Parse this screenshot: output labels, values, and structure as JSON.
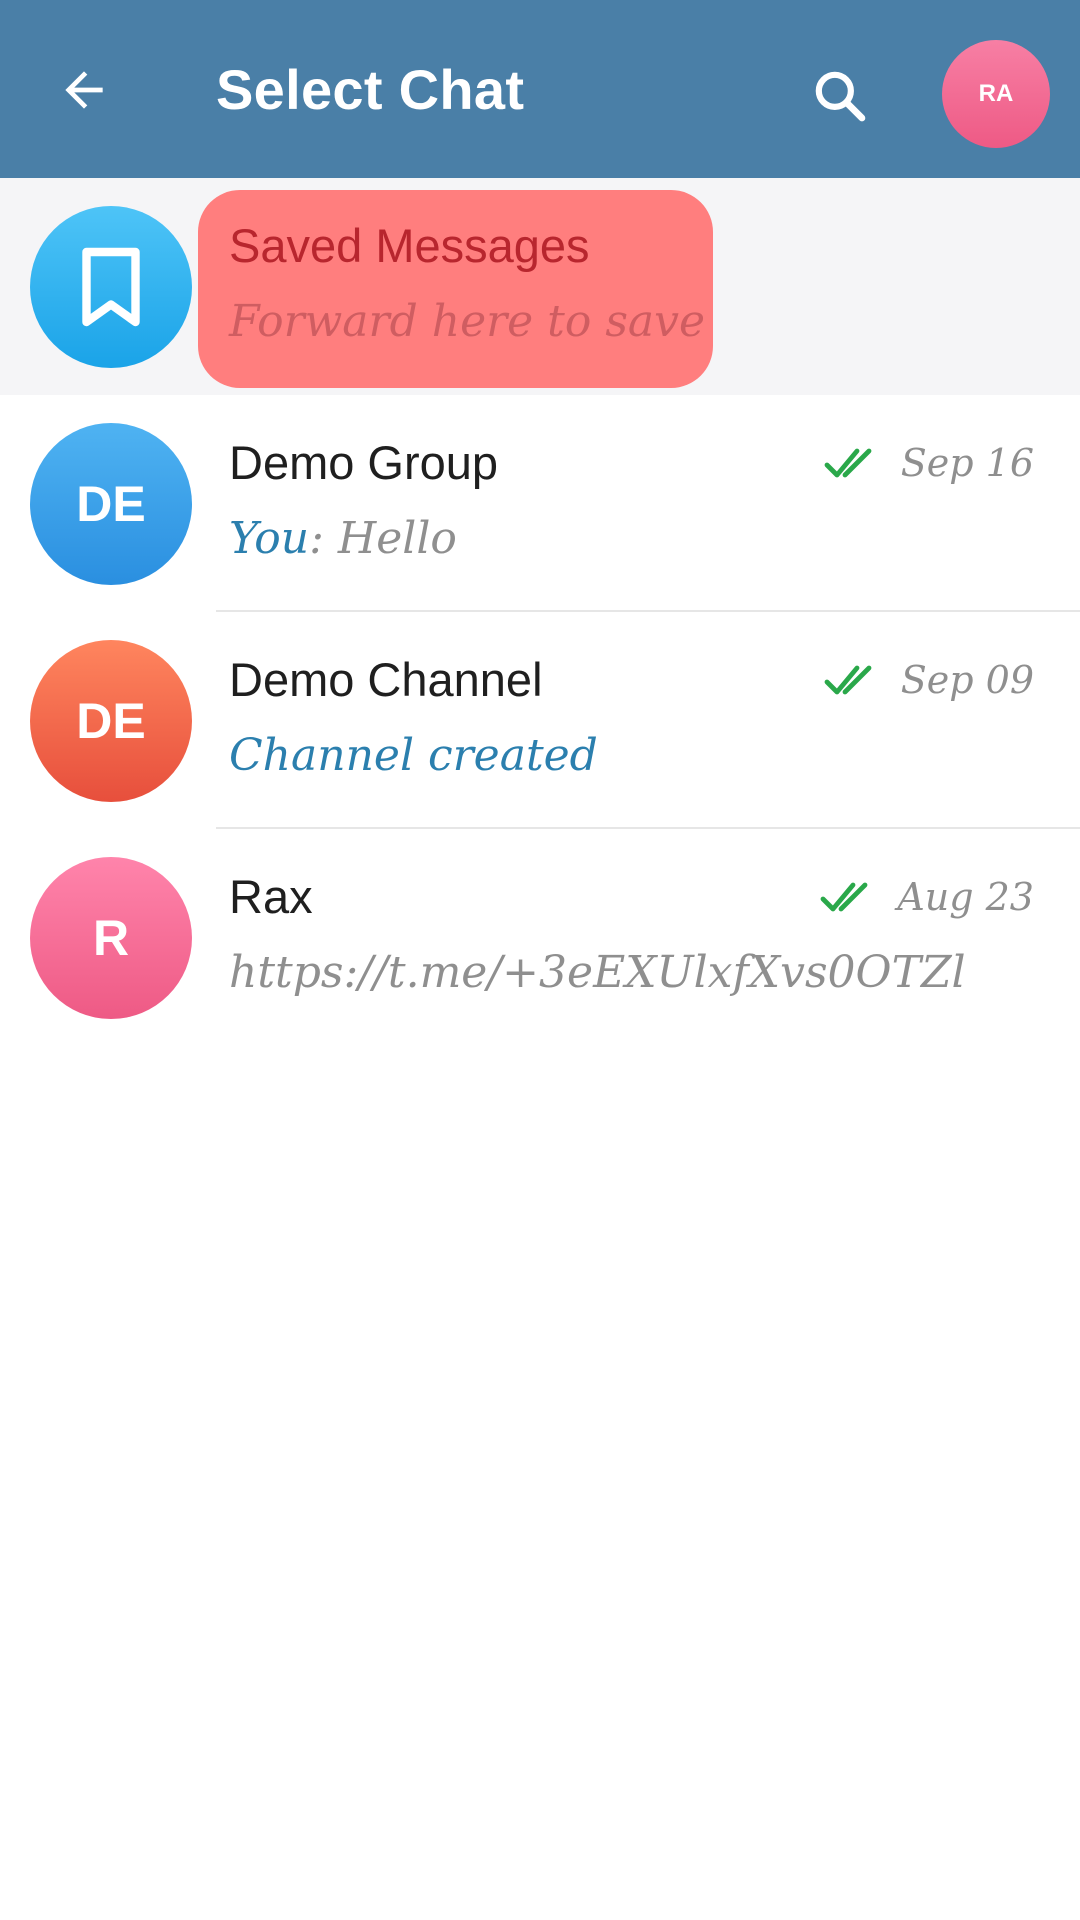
{
  "header": {
    "title": "Select Chat",
    "avatar_initials": "RA",
    "back_icon": "arrow-left-icon",
    "search_icon": "search-icon"
  },
  "chats": [
    {
      "name": "Saved Messages",
      "preview": "Forward here to save",
      "avatar_icon": "bookmark-icon"
    },
    {
      "name": "Demo Group",
      "avatar_initials": "DE",
      "preview_prefix": "You",
      "preview_separator": ": ",
      "preview": "Hello",
      "date": "Sep 16",
      "status_icon": "double-check-icon"
    },
    {
      "name": "Demo Channel",
      "avatar_initials": "DE",
      "preview": "Channel created",
      "date": "Sep 09",
      "status_icon": "double-check-icon"
    },
    {
      "name": "Rax",
      "avatar_initials": "R",
      "preview": "https://t.me/+3eEXUlxfXvs0OTZl",
      "date": "Aug 23",
      "status_icon": "double-check-icon"
    }
  ],
  "colors": {
    "header_bg": "#4a7fa7",
    "highlight": "#ff7e7e",
    "check_green": "#2aa84a",
    "accent_blue": "#2b7fae"
  }
}
